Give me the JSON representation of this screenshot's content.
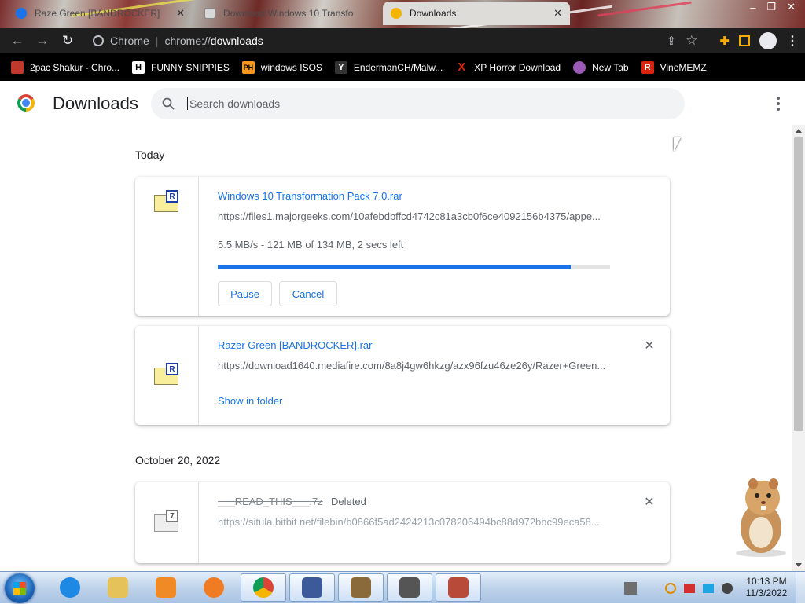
{
  "browser": {
    "tabs": [
      {
        "label": "Raze Green [BANDROCKER]",
        "icon": "download-favicon",
        "color": "#1a73e8"
      },
      {
        "label": "Download Windows 10 Transfo",
        "icon": "page-favicon",
        "color": "#8a8a8a"
      },
      {
        "label": "Downloads",
        "icon": "chrome-favicon",
        "color": "#f4b400"
      }
    ],
    "window_controls": [
      "–",
      "❐",
      "✕"
    ],
    "address": {
      "site": "Chrome",
      "scheme": "chrome://",
      "host": "downloads"
    },
    "bookmarks": [
      {
        "label": "2pac Shakur - Chro...",
        "icon": "lock-icon",
        "color": "#c0392b"
      },
      {
        "label": "FUNNY SNIPPIES",
        "icon": "h-icon",
        "glyph": "H",
        "color": "#000"
      },
      {
        "label": "windows ISOS",
        "icon": "ph-icon",
        "glyph": "PH",
        "color": "#f7971d"
      },
      {
        "label": "EndermanCH/Malw...",
        "icon": "yp-icon",
        "glyph": "Y",
        "color": "#222"
      },
      {
        "label": "XP Horror Download",
        "icon": "x-icon",
        "glyph": "X",
        "color": "#d9230f"
      },
      {
        "label": "New Tab",
        "icon": "globe-icon",
        "color": "#9b59b6"
      },
      {
        "label": "VineMEMZ",
        "icon": "r-icon",
        "glyph": "R",
        "color": "#d9230f"
      }
    ]
  },
  "page": {
    "title": "Downloads",
    "search_placeholder": "Search downloads",
    "groups": [
      {
        "date": "Today"
      },
      {
        "date": "October 20, 2022"
      }
    ],
    "downloads": [
      {
        "name": "Windows 10 Transformation Pack 7.0.rar",
        "badge": "R",
        "url": "https://files1.majorgeeks.com/10afebdbffcd4742c81a3cb0f6ce4092156b4375/appe...",
        "status": "5.5 MB/s - 121 MB of 134 MB, 2 secs left",
        "progress": 0.9,
        "pause_label": "Pause",
        "cancel_label": "Cancel"
      },
      {
        "name": "Razer Green [BANDROCKER].rar",
        "badge": "R",
        "url": "https://download1640.mediafire.com/8a8j4gw6hkzg/azx96fzu46ze26y/Razer+Green...",
        "show_label": "Show in folder",
        "remove": "✕"
      },
      {
        "name": "___READ_THIS___.7z",
        "badge": "7",
        "deleted_label": "Deleted",
        "url": "https://situla.bitbit.net/filebin/b0866f5ad2424213c078206494bc88d972bbc99eca58...",
        "remove": "✕"
      }
    ]
  },
  "taskbar": {
    "apps": [
      {
        "name": "internet-explorer",
        "color": "#1e88e5"
      },
      {
        "name": "file-explorer",
        "color": "#e6c25a"
      },
      {
        "name": "media-player",
        "color": "#f08a24"
      },
      {
        "name": "uc-browser",
        "color": "#ef7b22"
      },
      {
        "name": "chrome",
        "color": "#4285f4",
        "active": true
      },
      {
        "name": "document-window",
        "color": "#3c5a9a"
      },
      {
        "name": "bonzi-box",
        "color": "#8a6a3a"
      },
      {
        "name": "bandicam",
        "color": "#555"
      },
      {
        "name": "game-app",
        "color": "#b84a3a"
      }
    ],
    "clock": {
      "time": "10:13 PM",
      "date": "11/3/2022"
    }
  },
  "colors": {
    "accent": "#1a73e8",
    "bookmarks_bg": "#000000",
    "toolbar_bg": "#1f1f1f"
  }
}
